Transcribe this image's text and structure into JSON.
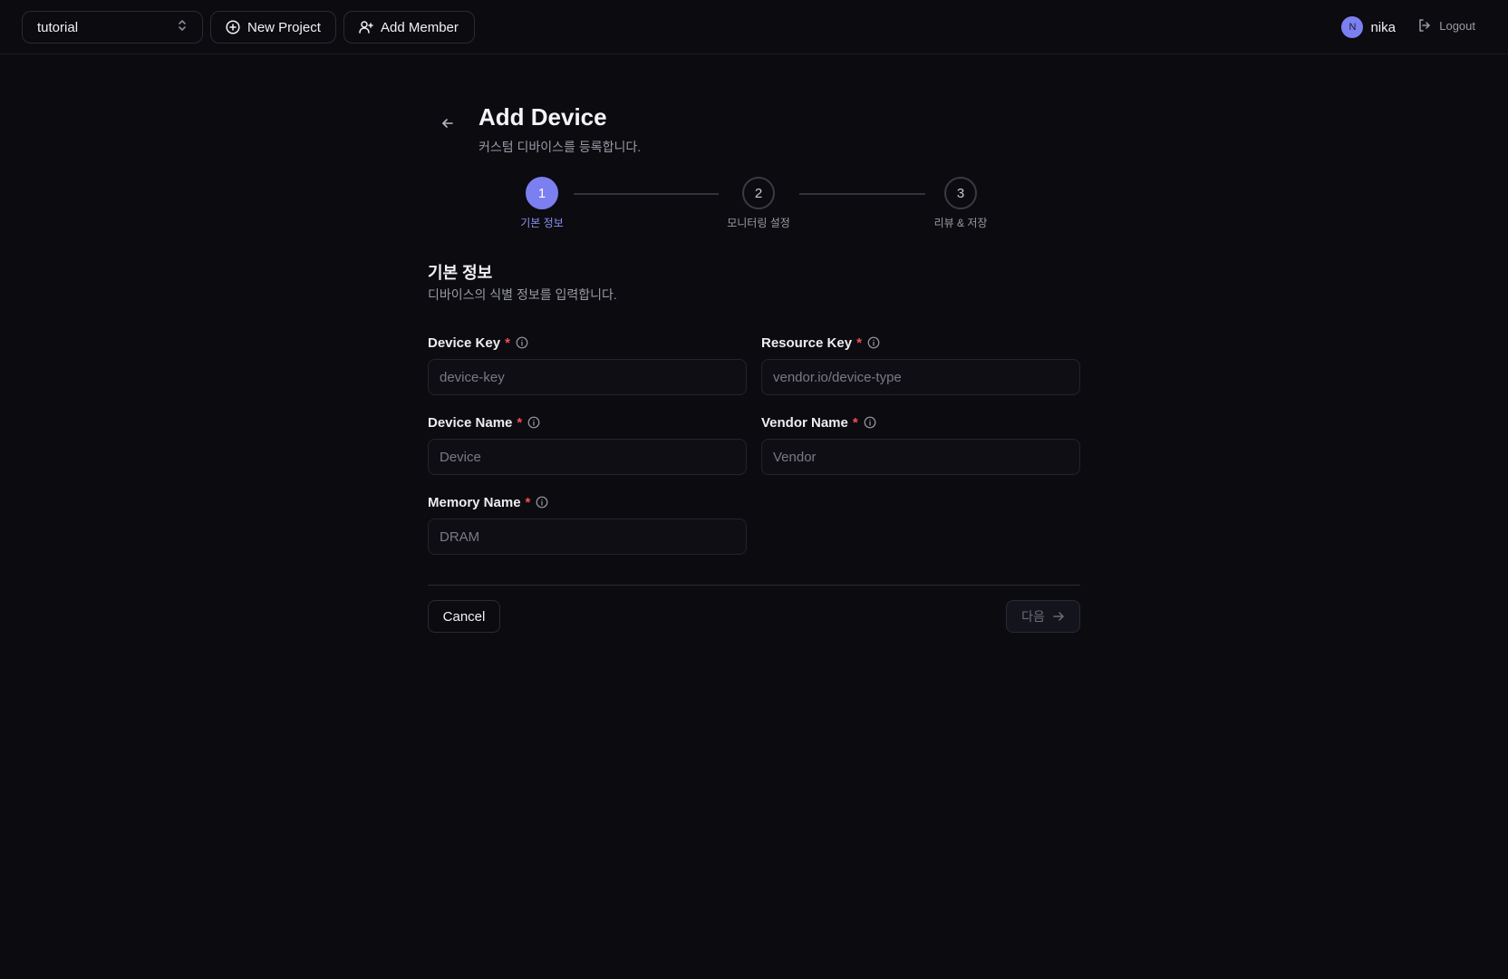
{
  "header": {
    "project_selector": {
      "value": "tutorial",
      "icon": "chevron-up-down-icon"
    },
    "new_project_label": "New Project",
    "add_member_label": "Add Member",
    "user": {
      "avatar_initial": "N",
      "name": "nika"
    },
    "logout_label": "Logout"
  },
  "page": {
    "title": "Add Device",
    "subtitle": "커스텀 디바이스를 등록합니다."
  },
  "stepper": {
    "steps": [
      {
        "number": "1",
        "label": "기본 정보",
        "active": true
      },
      {
        "number": "2",
        "label": "모니터링 설정",
        "active": false
      },
      {
        "number": "3",
        "label": "리뷰 & 저장",
        "active": false
      }
    ]
  },
  "section": {
    "title": "기본 정보",
    "description": "디바이스의 식별 정보를 입력합니다."
  },
  "form": {
    "required_mark": "*",
    "device_key": {
      "label": "Device Key",
      "placeholder": "device-key",
      "value": ""
    },
    "resource_key": {
      "label": "Resource Key",
      "placeholder": "vendor.io/device-type",
      "value": ""
    },
    "device_name": {
      "label": "Device Name",
      "placeholder": "Device",
      "value": ""
    },
    "vendor_name": {
      "label": "Vendor Name",
      "placeholder": "Vendor",
      "value": ""
    },
    "memory_name": {
      "label": "Memory Name",
      "placeholder": "DRAM",
      "value": ""
    }
  },
  "actions": {
    "cancel_label": "Cancel",
    "next_label": "다음"
  },
  "colors": {
    "background": "#0b0b10",
    "accent": "#7c7ff0",
    "required": "#ef5350"
  }
}
